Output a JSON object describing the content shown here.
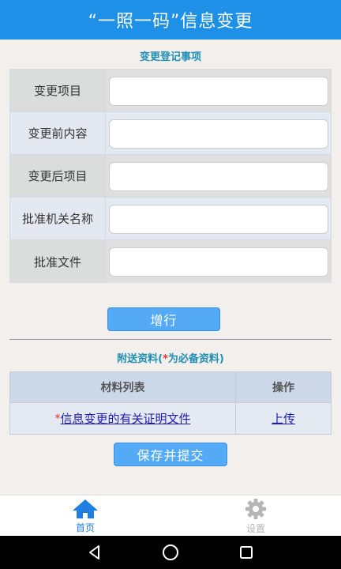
{
  "header": {
    "title": "“一照一码”信息变更"
  },
  "change_section": {
    "title": "变更登记事项",
    "rows": [
      {
        "label": "变更项目",
        "value": ""
      },
      {
        "label": "变更前内容",
        "value": ""
      },
      {
        "label": "变更后项目",
        "value": ""
      },
      {
        "label": "批准机关名称",
        "value": ""
      },
      {
        "label": "批准文件",
        "value": ""
      }
    ],
    "add_row_label": "增行"
  },
  "attachments": {
    "title_prefix": "附送资料(",
    "title_star": "*",
    "title_suffix": "为必备资料)",
    "columns": [
      "材料列表",
      "操作"
    ],
    "rows": [
      {
        "required_mark": "*",
        "name": "信息变更的有关证明文件",
        "action": "上传"
      }
    ]
  },
  "save_label": "保存并提交",
  "tabbar": {
    "tabs": [
      {
        "label": "首页",
        "icon": "home-icon",
        "active": true
      },
      {
        "label": "设置",
        "icon": "gear-icon",
        "active": false
      }
    ]
  },
  "colors": {
    "titlebar": "#1e90e8",
    "accent_button": "#55aaf5",
    "section_title": "#1f8fb3",
    "required": "#e0302a",
    "link": "#1f1ab8",
    "tab_active": "#1e7fe0",
    "tab_inactive": "#b5b5b5"
  }
}
